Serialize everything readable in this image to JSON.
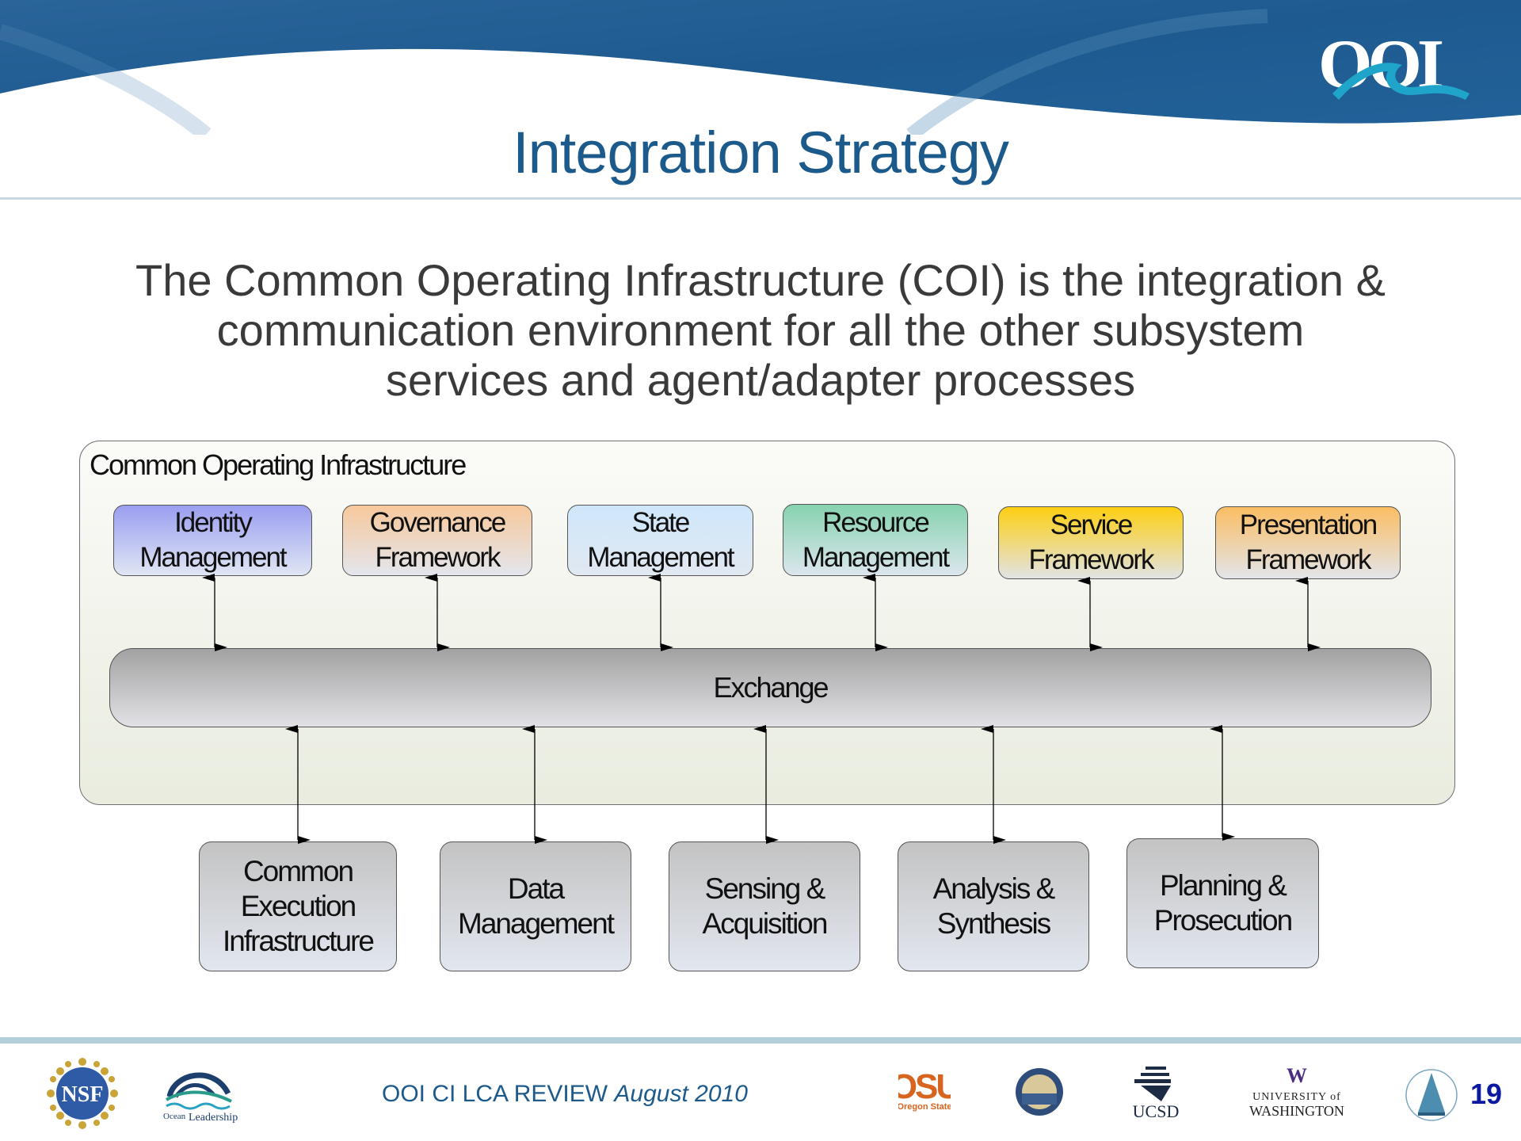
{
  "header": {
    "logo_text": "OOI",
    "title": "Integration Strategy"
  },
  "intro": {
    "lines": [
      "The Common Operating Infrastructure (COI) is the integration &",
      "communication environment for all the other subsystem",
      "services and agent/adapter processes"
    ]
  },
  "diagram": {
    "container_label": "Common Operating Infrastructure",
    "top_services": [
      {
        "line1": "Identity",
        "line2": "Management",
        "color_top": "#9a9ef0",
        "color_bottom": "#dfe6f3"
      },
      {
        "line1": "Governance",
        "line2": "Framework",
        "color_top": "#f7c89c",
        "color_bottom": "#e3e6ed"
      },
      {
        "line1": "State",
        "line2": "Management",
        "color_top": "#cfe7fb",
        "color_bottom": "#e1e8f1"
      },
      {
        "line1": "Resource",
        "line2": "Management",
        "color_top": "#86d2ae",
        "color_bottom": "#dce6ee"
      },
      {
        "line1": "Service",
        "line2": "Framework",
        "color_top": "#fdcf12",
        "color_bottom": "#e1e3e6"
      },
      {
        "line1": "Presentation",
        "line2": "Framework",
        "color_top": "#fbbd63",
        "color_bottom": "#e2e5ea"
      }
    ],
    "exchange_label": "Exchange",
    "bottom_subsystems": [
      {
        "lines": [
          "Common",
          "Execution",
          "Infrastructure"
        ]
      },
      {
        "lines": [
          "Data",
          "Management"
        ]
      },
      {
        "lines": [
          "Sensing &",
          "Acquisition"
        ]
      },
      {
        "lines": [
          "Analysis &",
          "Synthesis"
        ]
      },
      {
        "lines": [
          "Planning &",
          "Prosecution"
        ]
      }
    ]
  },
  "footer": {
    "review_text": "OOI CI LCA REVIEW",
    "date_text": "August 2010",
    "page_number": "19",
    "logos": [
      "NSF",
      "Consortium for Ocean Leadership",
      "Oregon State University",
      "Scripps Institution of Oceanography",
      "UCSD",
      "University of Washington",
      "Woods Hole Oceanographic Institution"
    ],
    "osu_text": "OSU",
    "osu_sub": "Oregon State",
    "ucsd_text": "UCSD",
    "uw_w": "W",
    "uw_line1": "UNIVERSITY of",
    "uw_line2": "WASHINGTON",
    "ol_line1": "Ocean",
    "ol_line2": "Leadership",
    "nsf_text": "NSF"
  }
}
